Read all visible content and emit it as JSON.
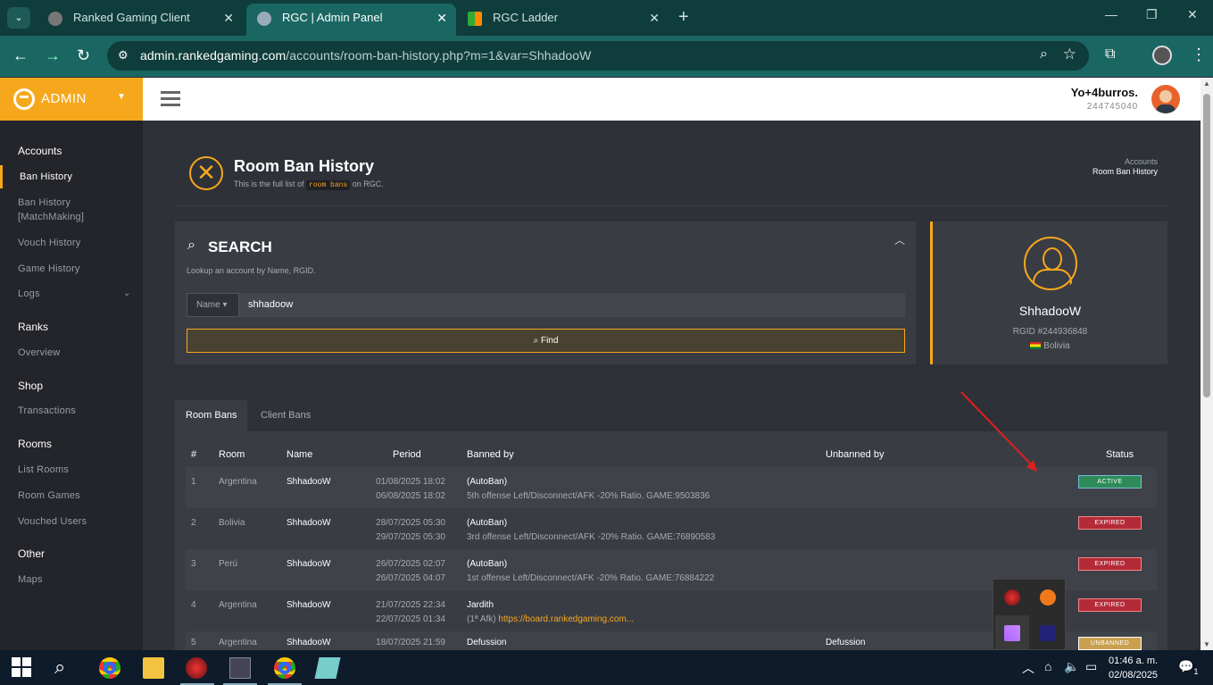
{
  "browser": {
    "tabs": [
      {
        "title": "Ranked Gaming Client",
        "active": false
      },
      {
        "title": "RGC | Admin Panel",
        "active": true
      },
      {
        "title": "RGC Ladder",
        "active": false
      }
    ],
    "url_host": "admin.rankedgaming.com",
    "url_path": "/accounts/room-ban-history.php?m=1&var=ShhadooW"
  },
  "brand": {
    "label": "ADMIN",
    "color": "#f6a81c"
  },
  "user": {
    "name": "Yo+4burros.",
    "id": "244745040"
  },
  "sidebar": {
    "sections": [
      {
        "title": "Accounts",
        "items": [
          "Ban History",
          "Ban History [MatchMaking]",
          "Vouch History",
          "Game History",
          "Logs"
        ]
      },
      {
        "title": "Ranks",
        "items": [
          "Overview"
        ]
      },
      {
        "title": "Shop",
        "items": [
          "Transactions"
        ]
      },
      {
        "title": "Rooms",
        "items": [
          "List Rooms",
          "Room Games",
          "Vouched Users"
        ]
      },
      {
        "title": "Other",
        "items": [
          "Maps"
        ]
      }
    ],
    "selected": "Ban History"
  },
  "page": {
    "title": "Room Ban History",
    "subtitle_pre": "This is the full list of",
    "subtitle_code": "room bans",
    "subtitle_post": "on RGC.",
    "breadcrumb": [
      "Accounts",
      "Room Ban History"
    ]
  },
  "search": {
    "title": "SEARCH",
    "description": "Lookup an account by Name, RGID.",
    "field_type": "Name",
    "value": "shhadoow",
    "button": "Find"
  },
  "profile": {
    "name": "ShhadooW",
    "rgid": "RGID #244936848",
    "country": "Bolivia"
  },
  "tabs": [
    "Room Bans",
    "Client Bans"
  ],
  "table": {
    "headers": [
      "#",
      "Room",
      "Name",
      "Period",
      "Banned by",
      "Unbanned by",
      "Status"
    ],
    "rows": [
      {
        "n": "1",
        "room": "Argentina",
        "name": "ShhadooW",
        "from": "01/08/2025 18:02",
        "to": "06/08/2025 18:02",
        "by": "(AutoBan)",
        "reason": "5th offense Left/Disconnect/AFK -20% Ratio. GAME:9503836",
        "unbanned_by": "",
        "status": "ACTIVE"
      },
      {
        "n": "2",
        "room": "Bolivia",
        "name": "ShhadooW",
        "from": "28/07/2025 05:30",
        "to": "29/07/2025 05:30",
        "by": "(AutoBan)",
        "reason": "3rd offense Left/Disconnect/AFK -20% Ratio. GAME:76890583",
        "unbanned_by": "",
        "status": "EXPIRED"
      },
      {
        "n": "3",
        "room": "Perú",
        "name": "ShhadooW",
        "from": "26/07/2025 02:07",
        "to": "26/07/2025 04:07",
        "by": "(AutoBan)",
        "reason": "1st offense Left/Disconnect/AFK -20% Ratio. GAME:76884222",
        "unbanned_by": "",
        "status": "EXPIRED"
      },
      {
        "n": "4",
        "room": "Argentina",
        "name": "ShhadooW",
        "from": "21/07/2025 22:34",
        "to": "22/07/2025 01:34",
        "by": "Jardith",
        "reason_pre": "(1ª Afk)",
        "reason_link": "https://board.rankedgaming.com...",
        "unbanned_by": "",
        "status": "EXPIRED"
      },
      {
        "n": "5",
        "room": "Argentina",
        "name": "ShhadooW",
        "from": "18/07/2025 21:59",
        "to": "",
        "by": "Defussion",
        "reason": "",
        "unbanned_by": "Defussion",
        "status": "UNBANNED"
      }
    ]
  },
  "taskbar": {
    "time": "01:46 a. m.",
    "date": "02/08/2025",
    "notifications": "1"
  }
}
